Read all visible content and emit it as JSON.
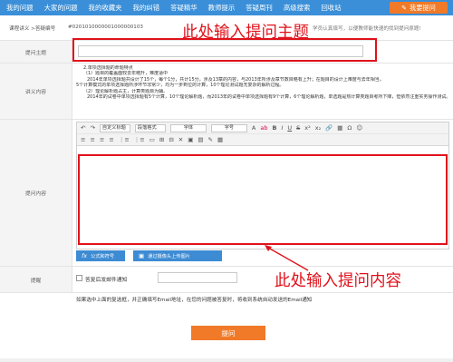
{
  "nav": {
    "items": [
      "我的问题",
      "大家的问题",
      "我的收藏夹",
      "我的纠错",
      "答疑精华",
      "教师提示",
      "答疑周刊",
      "高级搜索",
      "回收站"
    ],
    "ask_button": "我要提问"
  },
  "breadcrumb": {
    "label": "课程讲义 >答疑编号",
    "code": "#0201010000001000000103",
    "tip": "学员认真填写，以便教师能快速的找到提问原题!"
  },
  "form": {
    "title_label": "提问主题",
    "content_label": "讲义内容",
    "question_label": "提问内容",
    "remind_label": "提醒",
    "remind_checkbox": "答复后发邮件通知",
    "note": "如果选中上面的复选框，并正确填写Email地址，在您的问题被答复时，将收到系统自动发送的Email通知",
    "submit": "提问"
  },
  "lecture": {
    "lines": [
      "2.单项选择题的命题特点",
      "（1）题目的覆盖面较去年略升，难度适中",
      "2014年单项选择题共设计了15个，每个1分，共计15分，涉及13章的内容，与2013年所涉及章节数目略有上升；在题目的设计上难度与去年相当，",
      "5个计算模式的单项选择题所涉环节非常少，均为一步到位的计算，10个理论测试题无复杂的解析过程。",
      "（2）理论解析题占主，计算类题目为辅。",
      "2014年的试卷中单项选择题有5个计算，10个理论解析题，而2013年的试卷中单项选择题有9个计算，6个理论解析题，单选题是热计算类题目考所下降，但依然注重实务操作测试。"
    ]
  },
  "editor": {
    "toolbar1": [
      "↶",
      "↷",
      "|",
      "自定义标题",
      "段落格式",
      "字体",
      "字号",
      "|",
      "A",
      "ab",
      "|",
      "B",
      "I",
      "U",
      "S",
      "x²",
      "x₂",
      "|",
      "🔗",
      "▦",
      "Ω",
      "☺"
    ],
    "selects": {
      "custom_title": "自定义标题",
      "paragraph": "段落格式",
      "font": "字体",
      "size": "字号"
    },
    "toolbar2": [
      "≡",
      "≡",
      "≡",
      "≡",
      "|",
      "⋮≡",
      "⋮≡",
      "|",
      "▭",
      "⊞",
      "⊟",
      "✕",
      "|",
      "▣",
      "▤",
      "✎",
      "▦"
    ],
    "formula_button": "公式和符号",
    "upload_button": "通过摄像头上传图片"
  },
  "annotations": {
    "title_hint": "此处输入提问主题",
    "content_hint": "此处输入提问内容"
  },
  "colors": {
    "nav_bg": "#3a8fd8",
    "accent_orange": "#f07a28",
    "annotation_red": "#e0121b",
    "editor_button_blue": "#3d8bd3"
  }
}
